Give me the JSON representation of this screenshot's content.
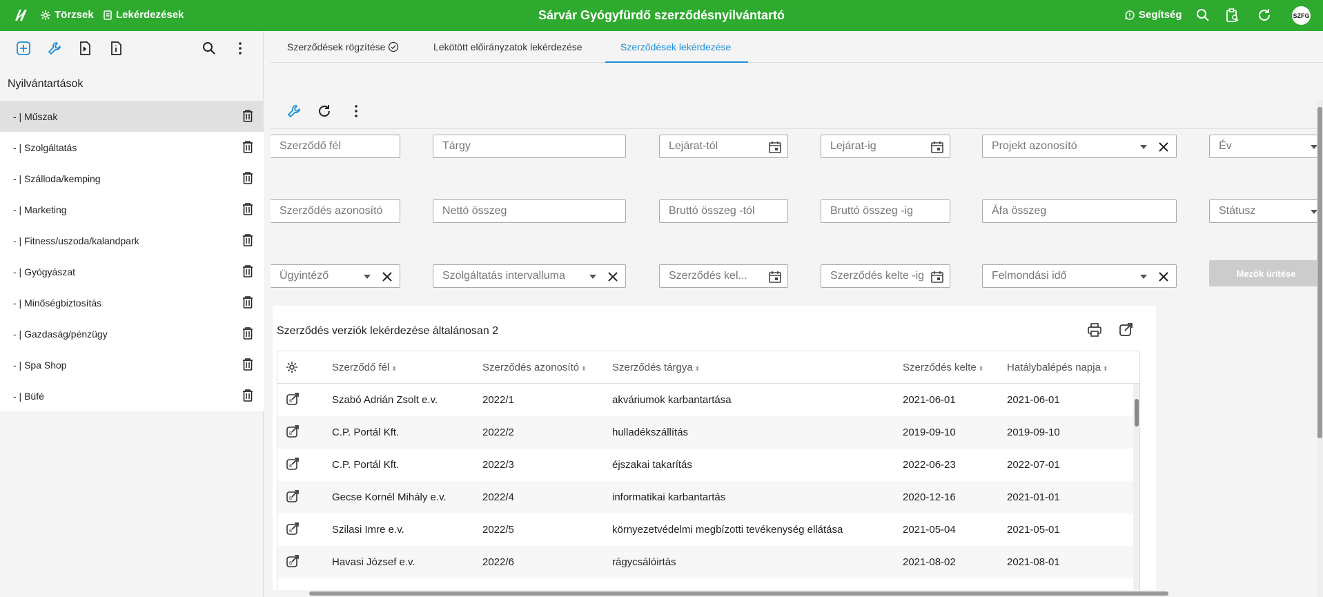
{
  "topbar": {
    "nav_torzsek": "Törzsek",
    "nav_lekerdezesek": "Lekérdezések",
    "title": "Sárvár Gyógyfürdő szerződésnyilvántartó",
    "help": "Segítség",
    "avatar": "SZFG",
    "bg_color": "#2eaa2e"
  },
  "sidebar": {
    "heading": "Nyilvántartások",
    "items": [
      {
        "label": "- | Műszak",
        "active": true
      },
      {
        "label": "- | Szolgáltatás"
      },
      {
        "label": "- | Szálloda/kemping"
      },
      {
        "label": "- | Marketing"
      },
      {
        "label": "- | Fitness/uszoda/kalandpark"
      },
      {
        "label": "- | Gyógyászat"
      },
      {
        "label": "- | Minőségbiztosítás"
      },
      {
        "label": "- | Gazdaság/pénzügy"
      },
      {
        "label": "- | Spa Shop"
      },
      {
        "label": "- | Büfé"
      }
    ]
  },
  "tabs": [
    {
      "label": "Szerződések rögzítése"
    },
    {
      "label": "Lekötött előirányzatok lekérdezése"
    },
    {
      "label": "Szerződések lekérdezése",
      "active": true
    }
  ],
  "filters": {
    "szerzodo_fel": "Szerződő fél",
    "targy": "Tárgy",
    "lejarat_tol": "Lejárat-tól",
    "lejarat_ig": "Lejárat-ig",
    "projekt_azonosito": "Projekt azonosító",
    "ev": "Év",
    "szerzodes_azonosito": "Szerződés azonosító",
    "netto_osszeg": "Nettó összeg",
    "brutto_tol": "Bruttó összeg -tól",
    "brutto_ig": "Bruttó összeg -ig",
    "afa_osszeg": "Áfa összeg",
    "statusz": "Státusz",
    "ugyintezo": "Ügyintéző",
    "szolg_intervallum": "Szolgáltatás intervalluma",
    "kelte_tol": "Szerződés kel...",
    "kelte_ig": "Szerződés kelte -ig",
    "felmondasi_ido": "Felmondási idő",
    "clear_button": "Mezők ürítése"
  },
  "table": {
    "title": "Szerződés verziók lekérdezése általánosan 2",
    "columns": [
      "Szerződő fél",
      "Szerződés azonosító",
      "Szerződés tárgya",
      "Szerződés kelte",
      "Hatálybalépés napja"
    ],
    "rows": [
      [
        "Szabó Adrián Zsolt e.v.",
        "2022/1",
        "akváriumok karbantartása",
        "2021-06-01",
        "2021-06-01"
      ],
      [
        "C.P. Portál Kft.",
        "2022/2",
        "hulladékszállítás",
        "2019-09-10",
        "2019-09-10"
      ],
      [
        "C.P. Portál Kft.",
        "2022/3",
        "éjszakai takarítás",
        "2022-06-23",
        "2022-07-01"
      ],
      [
        "Gecse Kornél Mihály e.v.",
        "2022/4",
        "informatikai karbantartás",
        "2020-12-16",
        "2021-01-01"
      ],
      [
        "Szilasi Imre e.v.",
        "2022/5",
        "környezetvédelmi megbízotti tevékenység ellátása",
        "2021-05-04",
        "2021-05-01"
      ],
      [
        "Havasi József e.v.",
        "2022/6",
        "rágycsálóirtás",
        "2021-08-02",
        "2021-08-01"
      ]
    ]
  },
  "colors": {
    "accent": "#1a8fd6",
    "brand": "#2eaa2e"
  }
}
